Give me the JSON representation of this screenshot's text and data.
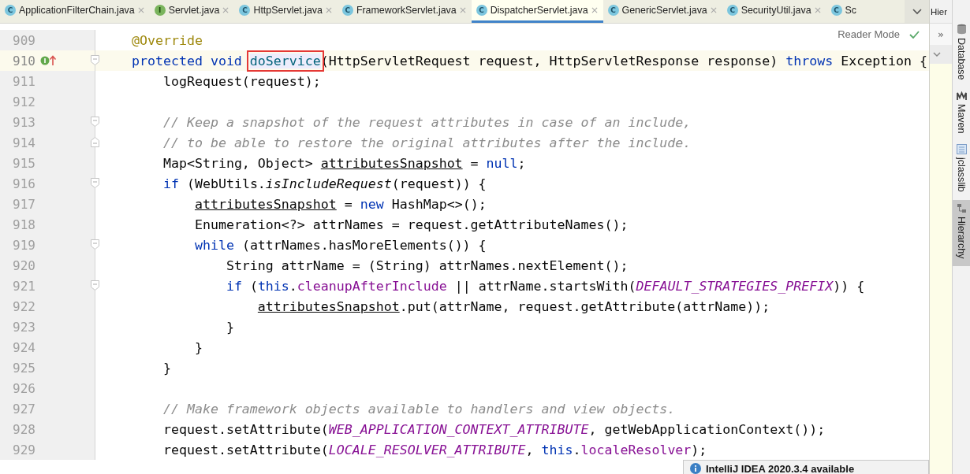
{
  "tabs": [
    {
      "label": "ApplicationFilterChain.java",
      "icon": "C",
      "kind": "class",
      "selected": false
    },
    {
      "label": "Servlet.java",
      "icon": "I",
      "kind": "interface",
      "selected": false
    },
    {
      "label": "HttpServlet.java",
      "icon": "C",
      "kind": "class",
      "selected": false
    },
    {
      "label": "FrameworkServlet.java",
      "icon": "C",
      "kind": "class",
      "selected": false
    },
    {
      "label": "DispatcherServlet.java",
      "icon": "C",
      "kind": "class",
      "selected": true
    },
    {
      "label": "GenericServlet.java",
      "icon": "C",
      "kind": "class",
      "selected": false
    },
    {
      "label": "SecurityUtil.java",
      "icon": "C",
      "kind": "class",
      "selected": false
    },
    {
      "label": "Sc",
      "icon": "C",
      "kind": "class",
      "selected": false
    }
  ],
  "side_panel": {
    "title": "Hier",
    "expand": "»"
  },
  "reader_mode": {
    "label": "Reader Mode"
  },
  "editor": {
    "lines": [
      {
        "number": "909",
        "current": false,
        "fold_start": false,
        "fold_end": false,
        "tokens": [
          {
            "kind": "annotation",
            "text": "@Override"
          }
        ]
      },
      {
        "number": "910",
        "current": true,
        "fold_start": true,
        "fold_end": false,
        "override": true,
        "tokens": [
          {
            "kind": "keyword",
            "text": "protected void "
          },
          {
            "kind": "boxed",
            "text": "doService"
          },
          {
            "kind": "plain",
            "text": "(HttpServletRequest request, HttpServletResponse response) "
          },
          {
            "kind": "keyword",
            "text": "throws"
          },
          {
            "kind": "plain",
            "text": " Exception {"
          }
        ]
      },
      {
        "number": "911",
        "current": false,
        "fold_start": false,
        "fold_end": false,
        "tokens": [
          {
            "kind": "plain",
            "text": "    logRequest(request);"
          }
        ]
      },
      {
        "number": "912",
        "current": false,
        "fold_start": false,
        "fold_end": false
      },
      {
        "number": "913",
        "current": false,
        "fold_start": true,
        "fold_end": false,
        "tokens": [
          {
            "kind": "comment",
            "text": "    // Keep a snapshot of the request attributes in case of an include,"
          }
        ]
      },
      {
        "number": "914",
        "current": false,
        "fold_start": false,
        "fold_end": true,
        "tokens": [
          {
            "kind": "comment",
            "text": "    // to be able to restore the original attributes after the include."
          }
        ]
      },
      {
        "number": "915",
        "current": false,
        "fold_start": false,
        "fold_end": false,
        "tokens": [
          {
            "kind": "plain",
            "text": "    Map<String, Object> "
          },
          {
            "kind": "reassigned",
            "text": "attributesSnapshot"
          },
          {
            "kind": "plain",
            "text": " = "
          },
          {
            "kind": "keyword",
            "text": "null"
          },
          {
            "kind": "plain",
            "text": ";"
          }
        ]
      },
      {
        "number": "916",
        "current": false,
        "fold_start": true,
        "fold_end": false,
        "tokens": [
          {
            "kind": "keyword",
            "text": "    if"
          },
          {
            "kind": "plain",
            "text": " (WebUtils."
          },
          {
            "kind": "static_method",
            "text": "isIncludeRequest"
          },
          {
            "kind": "plain",
            "text": "(request)) {"
          }
        ]
      },
      {
        "number": "917",
        "current": false,
        "fold_start": false,
        "fold_end": false,
        "tokens": [
          {
            "kind": "reassigned",
            "text": "        attributesSnapshot"
          },
          {
            "kind": "plain",
            "text": " = "
          },
          {
            "kind": "keyword",
            "text": "new"
          },
          {
            "kind": "plain",
            "text": " HashMap<>();"
          }
        ]
      },
      {
        "number": "918",
        "current": false,
        "fold_start": false,
        "fold_end": false,
        "tokens": [
          {
            "kind": "plain",
            "text": "        Enumeration<?> attrNames = request.getAttributeNames();"
          }
        ]
      },
      {
        "number": "919",
        "current": false,
        "fold_start": true,
        "fold_end": false,
        "tokens": [
          {
            "kind": "keyword",
            "text": "        while"
          },
          {
            "kind": "plain",
            "text": " (attrNames.hasMoreElements()) {"
          }
        ]
      },
      {
        "number": "920",
        "current": false,
        "fold_start": false,
        "fold_end": false,
        "tokens": [
          {
            "kind": "plain",
            "text": "            String attrName = (String) attrNames.nextElement();"
          }
        ]
      },
      {
        "number": "921",
        "current": false,
        "fold_start": true,
        "fold_end": false,
        "tokens": [
          {
            "kind": "keyword",
            "text": "            if"
          },
          {
            "kind": "plain",
            "text": " ("
          },
          {
            "kind": "keyword",
            "text": "this"
          },
          {
            "kind": "plain",
            "text": "."
          },
          {
            "kind": "field",
            "text": "cleanupAfterInclude"
          },
          {
            "kind": "plain",
            "text": " || attrName.startsWith("
          },
          {
            "kind": "constant",
            "text": "DEFAULT_STRATEGIES_PREFIX"
          },
          {
            "kind": "plain",
            "text": ")) {"
          }
        ]
      },
      {
        "number": "922",
        "current": false,
        "fold_start": false,
        "fold_end": false,
        "tokens": [
          {
            "kind": "reassigned",
            "text": "                attributesSnapshot"
          },
          {
            "kind": "plain",
            "text": ".put(attrName, request.getAttribute(attrName));"
          }
        ]
      },
      {
        "number": "923",
        "current": false,
        "fold_start": false,
        "fold_end": false,
        "tokens": [
          {
            "kind": "plain",
            "text": "            }"
          }
        ]
      },
      {
        "number": "924",
        "current": false,
        "fold_start": false,
        "fold_end": false,
        "tokens": [
          {
            "kind": "plain",
            "text": "        }"
          }
        ]
      },
      {
        "number": "925",
        "current": false,
        "fold_start": false,
        "fold_end": false,
        "tokens": [
          {
            "kind": "plain",
            "text": "    }"
          }
        ]
      },
      {
        "number": "926",
        "current": false,
        "fold_start": false,
        "fold_end": false
      },
      {
        "number": "927",
        "current": false,
        "fold_start": false,
        "fold_end": false,
        "tokens": [
          {
            "kind": "comment",
            "text": "    // Make framework objects available to handlers and view objects."
          }
        ]
      },
      {
        "number": "928",
        "current": false,
        "fold_start": false,
        "fold_end": false,
        "tokens": [
          {
            "kind": "plain",
            "text": "    request.setAttribute("
          },
          {
            "kind": "constant",
            "text": "WEB_APPLICATION_CONTEXT_ATTRIBUTE"
          },
          {
            "kind": "plain",
            "text": ", getWebApplicationContext());"
          }
        ]
      },
      {
        "number": "929",
        "current": false,
        "fold_start": false,
        "fold_end": false,
        "tokens": [
          {
            "kind": "plain",
            "text": "    request.setAttribute("
          },
          {
            "kind": "constant",
            "text": "LOCALE_RESOLVER_ATTRIBUTE"
          },
          {
            "kind": "plain",
            "text": ", "
          },
          {
            "kind": "keyword",
            "text": "this"
          },
          {
            "kind": "plain",
            "text": "."
          },
          {
            "kind": "field",
            "text": "localeResolver"
          },
          {
            "kind": "plain",
            "text": ");"
          }
        ]
      }
    ]
  },
  "notification": {
    "text": "IntelliJ IDEA 2020.3.4 available"
  },
  "tool_stripe": [
    {
      "label": "Database",
      "selected": false
    },
    {
      "label": "Maven",
      "selected": false
    },
    {
      "label": "jclasslib",
      "selected": false
    },
    {
      "label": "Hierarchy",
      "selected": true
    }
  ]
}
